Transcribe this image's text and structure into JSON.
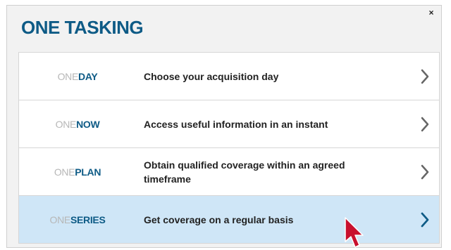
{
  "dialog": {
    "title": "ONE TASKING",
    "close_glyph": "×"
  },
  "items": [
    {
      "prefix": "ONE",
      "name": "DAY",
      "description": "Choose your acquisition day",
      "icon": "chevron-right-icon"
    },
    {
      "prefix": "ONE",
      "name": "NOW",
      "description": "Access useful information in an instant",
      "icon": "chevron-right-icon"
    },
    {
      "prefix": "ONE",
      "name": "PLAN",
      "description": "Obtain qualified coverage within an agreed timeframe",
      "icon": "chevron-right-icon"
    },
    {
      "prefix": "ONE",
      "name": "SERIES",
      "description": "Get coverage on a regular basis",
      "icon": "chevron-right-icon",
      "active": true
    }
  ],
  "colors": {
    "brand_blue": "#0e5b86",
    "active_row": "#cfe6f7",
    "chevron_gray": "#666666",
    "cursor_red": "#c8102e"
  }
}
